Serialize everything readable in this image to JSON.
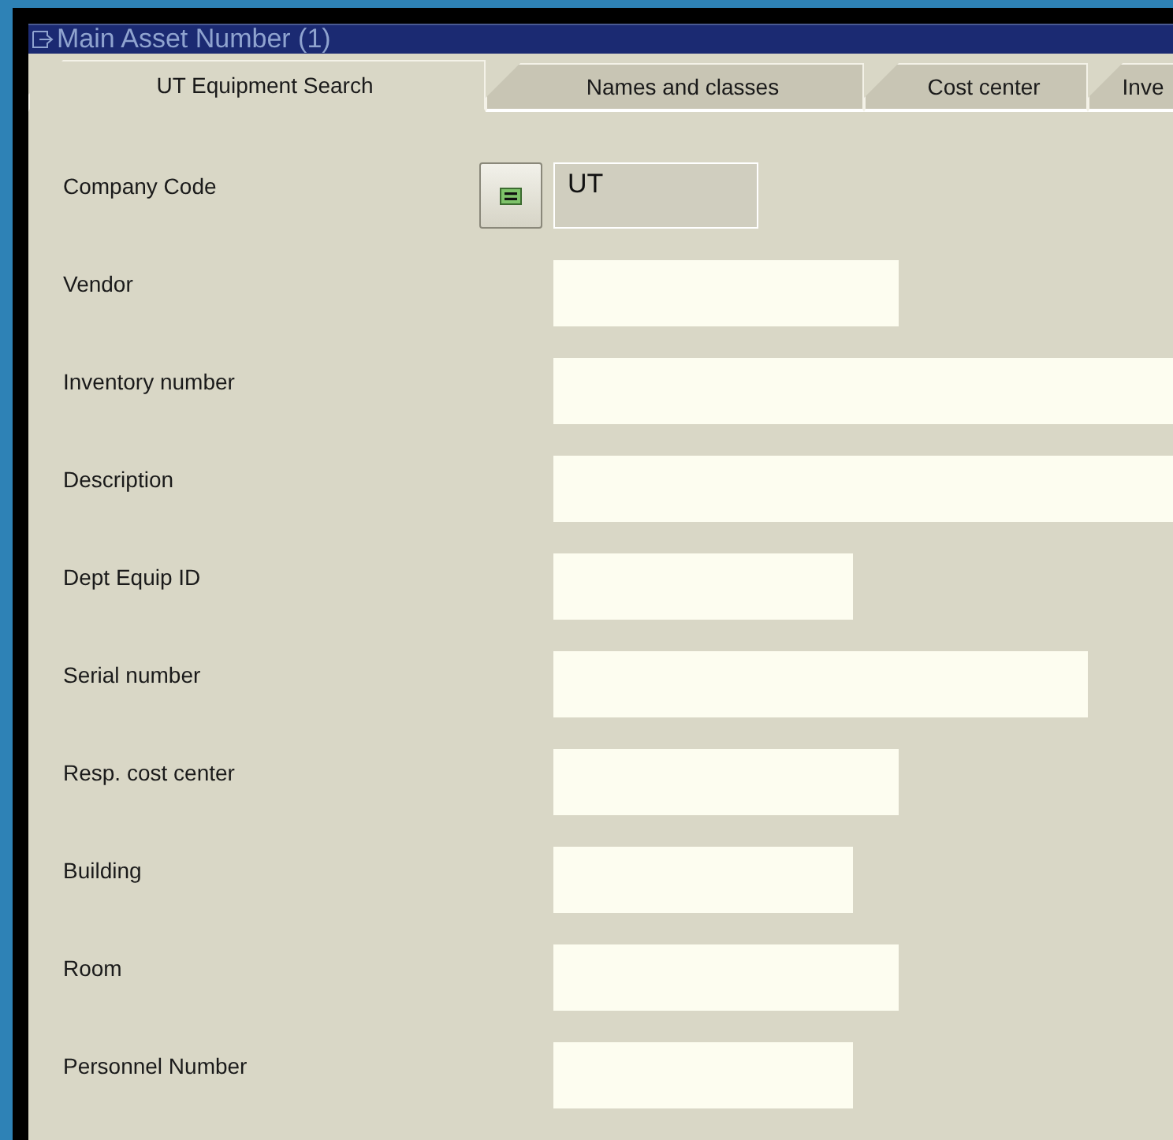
{
  "window": {
    "title": "Main Asset Number (1)"
  },
  "tabs": [
    {
      "label": "UT Equipment Search",
      "selected": true
    },
    {
      "label": "Names and classes",
      "selected": false
    },
    {
      "label": "Cost center",
      "selected": false
    },
    {
      "label": "Inve",
      "selected": false
    }
  ],
  "fields": [
    {
      "label": "Company Code",
      "value": "UT",
      "readonly": true,
      "has_button": true
    },
    {
      "label": "Vendor",
      "readonly": false,
      "has_button": false
    },
    {
      "label": "Inventory number",
      "readonly": false,
      "has_button": false
    },
    {
      "label": "Description",
      "readonly": false,
      "has_button": false
    },
    {
      "label": "Dept Equip ID",
      "readonly": false,
      "has_button": false
    },
    {
      "label": "Serial number",
      "readonly": false,
      "has_button": false
    },
    {
      "label": "Resp. cost center",
      "readonly": false,
      "has_button": false
    },
    {
      "label": "Building",
      "readonly": false,
      "has_button": false
    },
    {
      "label": "Room",
      "readonly": false,
      "has_button": false
    },
    {
      "label": "Personnel Number",
      "readonly": false,
      "has_button": false
    }
  ]
}
